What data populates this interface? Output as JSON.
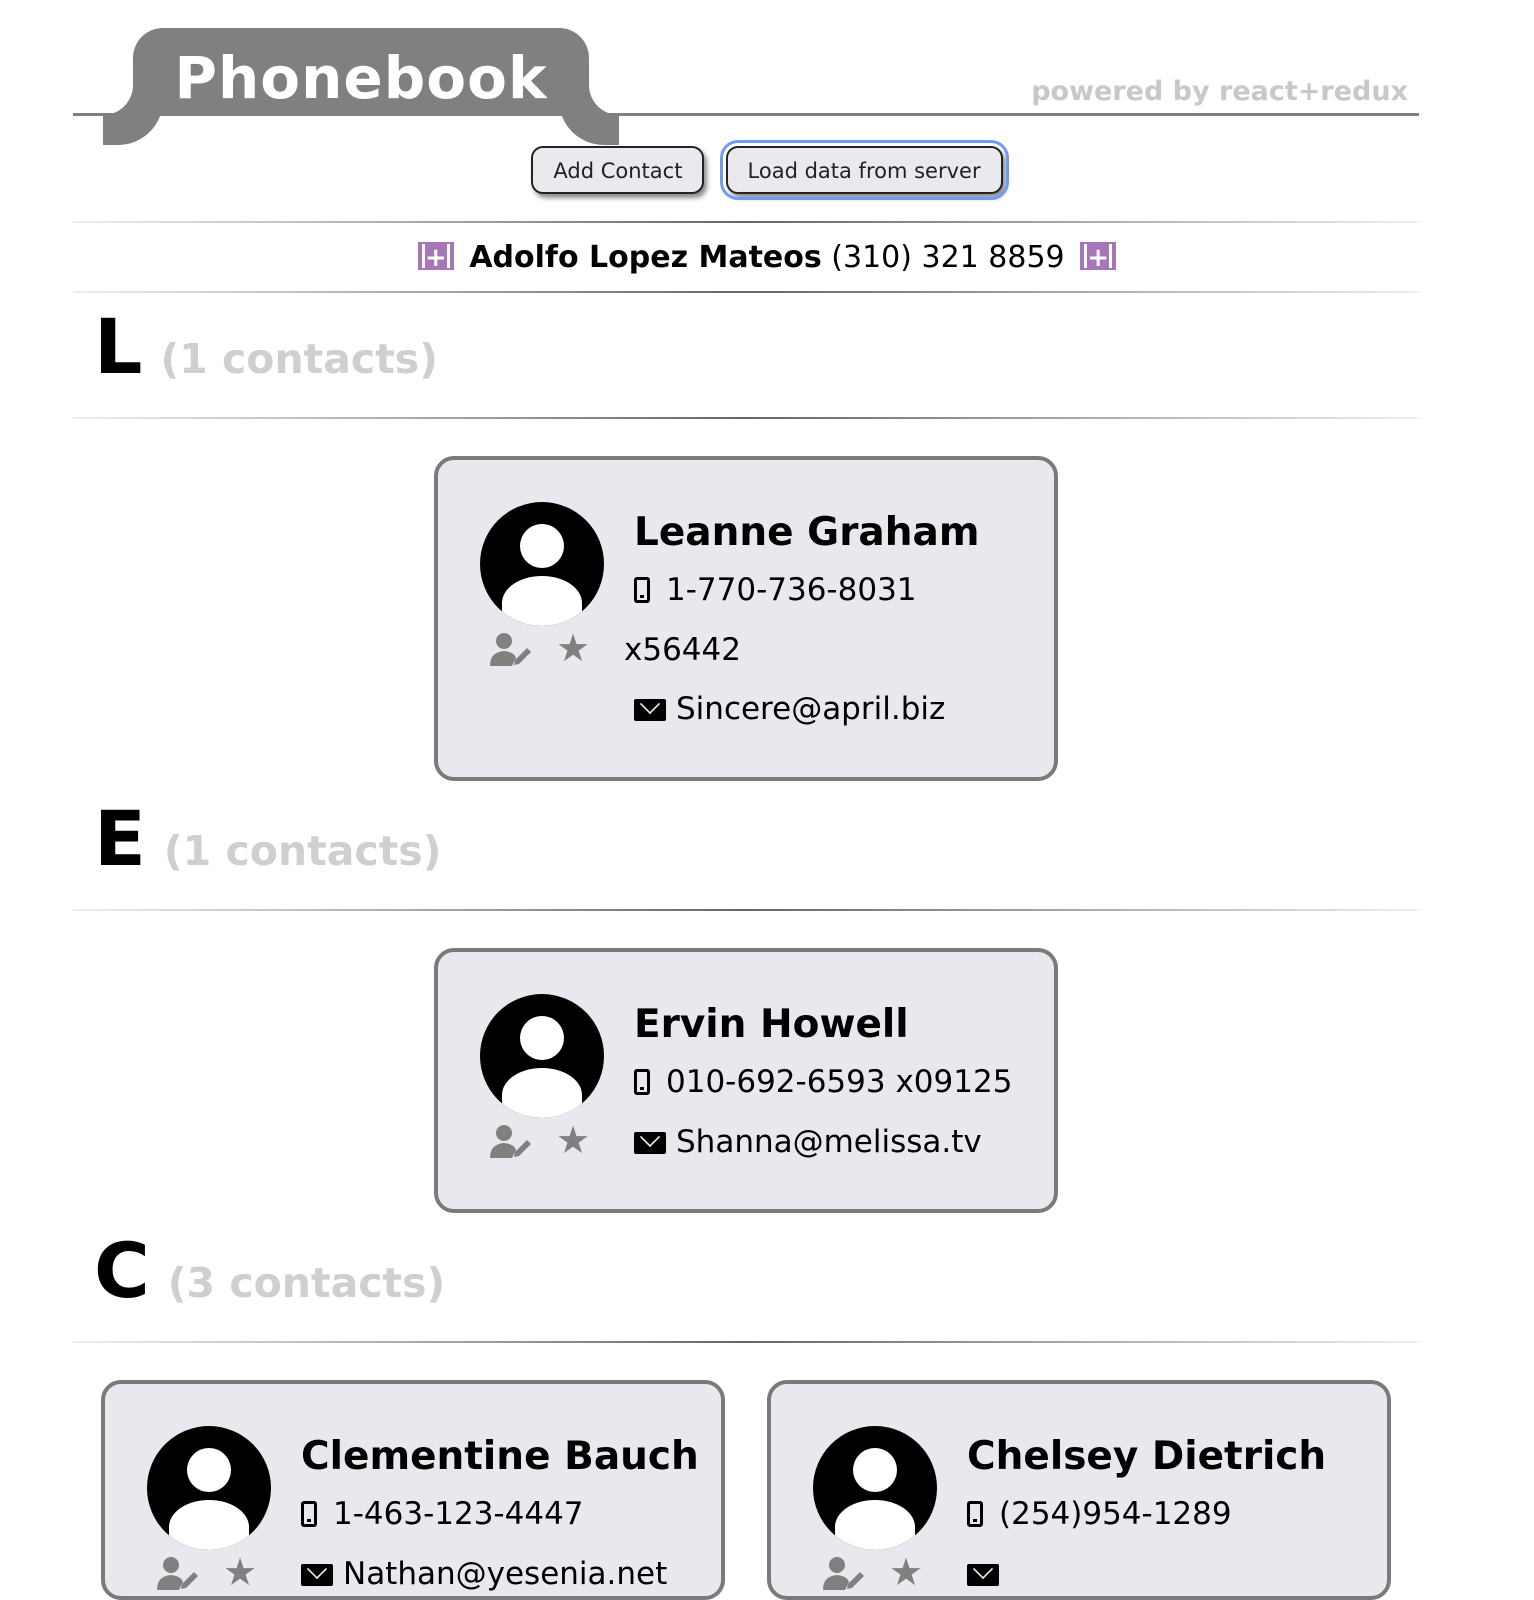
{
  "header": {
    "title": "Phonebook",
    "powered_by": "powered by react+redux"
  },
  "actions": {
    "add_contact": "Add Contact",
    "load_data": "Load data from server"
  },
  "featured": {
    "name": "Adolfo Lopez Mateos",
    "phone": "(310) 321 8859"
  },
  "sections": [
    {
      "letter": "L",
      "count_label": "(1 contacts)",
      "contacts": [
        {
          "name": "Leanne Graham",
          "phone": "1-770-736-8031",
          "phone_ext": "x56442",
          "email": "Sincere@april.biz"
        }
      ]
    },
    {
      "letter": "E",
      "count_label": "(1 contacts)",
      "contacts": [
        {
          "name": "Ervin Howell",
          "phone": "010-692-6593 x09125",
          "email": "Shanna@melissa.tv"
        }
      ]
    },
    {
      "letter": "C",
      "count_label": "(3 contacts)",
      "contacts": [
        {
          "name": "Clementine Bauch",
          "phone": "1-463-123-4447",
          "email": "Nathan@yesenia.net"
        },
        {
          "name": "Chelsey Dietrich",
          "phone": "(254)954-1289"
        }
      ]
    }
  ],
  "colors": {
    "header_tab": "#808080",
    "card_bg": "#e8e8ee",
    "featured_icon": "#a676b8",
    "focus_ring": "#6f9cf2",
    "muted_text": "#cfcfcf"
  },
  "icons": [
    "plus-square-icon",
    "user-avatar-icon",
    "edit-user-icon",
    "star-icon",
    "mobile-phone-icon",
    "envelope-icon"
  ]
}
